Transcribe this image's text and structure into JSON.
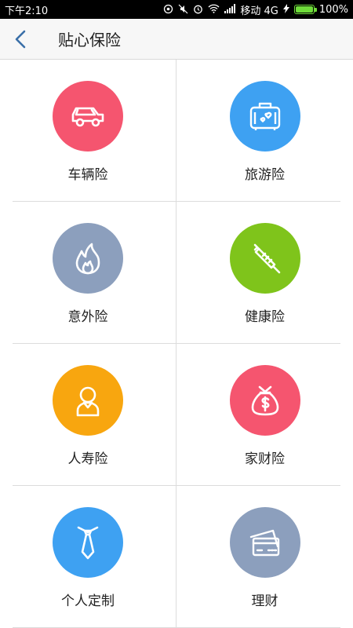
{
  "status_bar": {
    "time": "下午2:10",
    "carrier": "移动 4G",
    "battery_percent": "100%",
    "battery_level": 1.0,
    "battery_color": "#6fdc3a"
  },
  "header": {
    "title": "贴心保险"
  },
  "categories": [
    {
      "label": "车辆险",
      "icon": "car-icon",
      "color": "#f5556f"
    },
    {
      "label": "旅游险",
      "icon": "suitcase-icon",
      "color": "#3ea1f2"
    },
    {
      "label": "意外险",
      "icon": "flame-icon",
      "color": "#8c9fbd"
    },
    {
      "label": "健康险",
      "icon": "syringe-icon",
      "color": "#7fc41b"
    },
    {
      "label": "人寿险",
      "icon": "person-icon",
      "color": "#f8a60f"
    },
    {
      "label": "家财险",
      "icon": "money-bag-icon",
      "color": "#f5556f"
    },
    {
      "label": "个人定制",
      "icon": "tie-icon",
      "color": "#3ea1f2"
    },
    {
      "label": "理财",
      "icon": "card-icon",
      "color": "#8c9fbd"
    }
  ]
}
